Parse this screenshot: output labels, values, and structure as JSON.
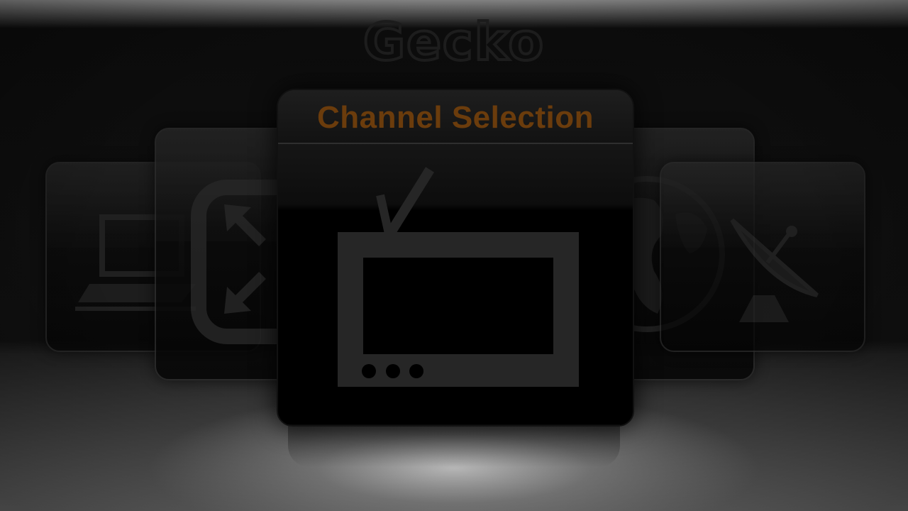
{
  "app": {
    "logo_text": "Gecko"
  },
  "menu": {
    "selected_title": "Channel Selection",
    "items": [
      {
        "icon": "laptop-icon"
      },
      {
        "icon": "resize-arrows-icon"
      },
      {
        "icon": "tv-icon"
      },
      {
        "icon": "globe-icon"
      },
      {
        "icon": "satellite-dish-icon"
      }
    ]
  },
  "colors": {
    "title_text": "#6b3c0c",
    "icon_gray": "#2a2a2a",
    "background_dark": "#0c0c0c"
  }
}
